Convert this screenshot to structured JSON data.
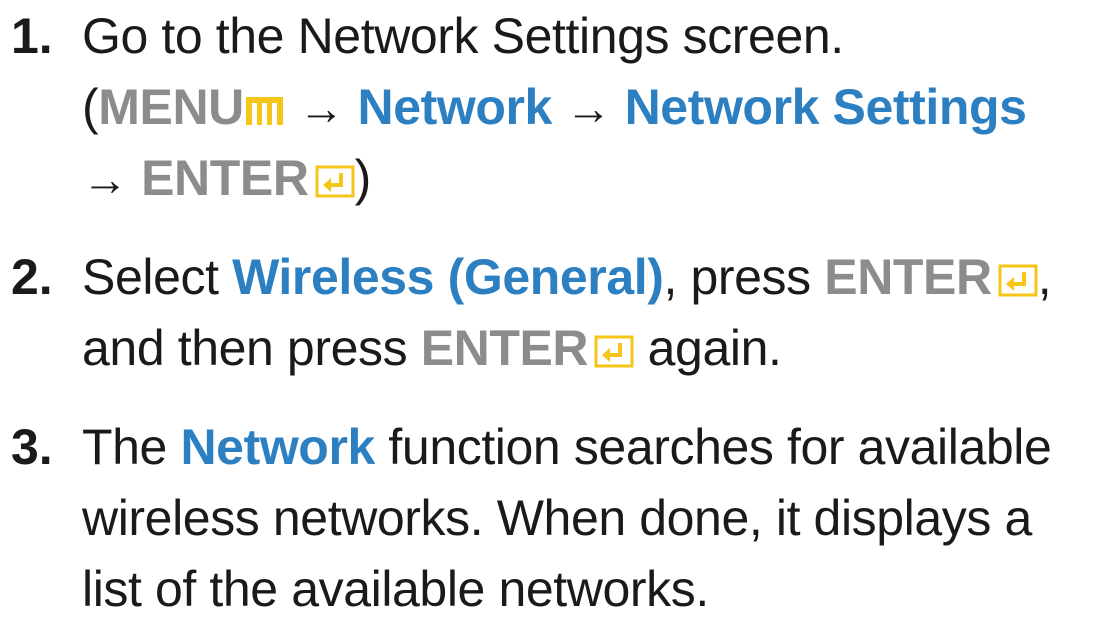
{
  "steps": [
    {
      "number": "1.",
      "lines": [
        {
          "t1": "Go to the Network Settings screen."
        },
        {
          "open_paren": "(",
          "menu_label": "MENU",
          "arrow1": "→",
          "network": "Network",
          "arrow2": "→",
          "network_settings": "Network Settings"
        },
        {
          "arrow": "→",
          "enter_label": "ENTER",
          "close_paren": ")"
        }
      ]
    },
    {
      "number": "2.",
      "lines": [
        {
          "select": "Select ",
          "wireless": "Wireless (General)",
          "press": ", press ",
          "enter_label": "ENTER",
          "comma": ","
        },
        {
          "and_then": "and then press ",
          "enter_label": "ENTER",
          "again": " again."
        }
      ]
    },
    {
      "number": "3.",
      "lines": [
        {
          "the": "The ",
          "network": "Network",
          "rest": " function searches for available"
        },
        {
          "t1": "wireless networks. When done, it displays a"
        },
        {
          "t1": "list of the available networks."
        }
      ]
    }
  ],
  "icons": {
    "menu_icon": "menu-icon",
    "enter_icon": "enter-icon"
  },
  "colors": {
    "text": "#1a1a1a",
    "gray_key": "#8c8c8c",
    "blue_link": "#2c7fc1",
    "icon_yellow": "#f5c518"
  }
}
